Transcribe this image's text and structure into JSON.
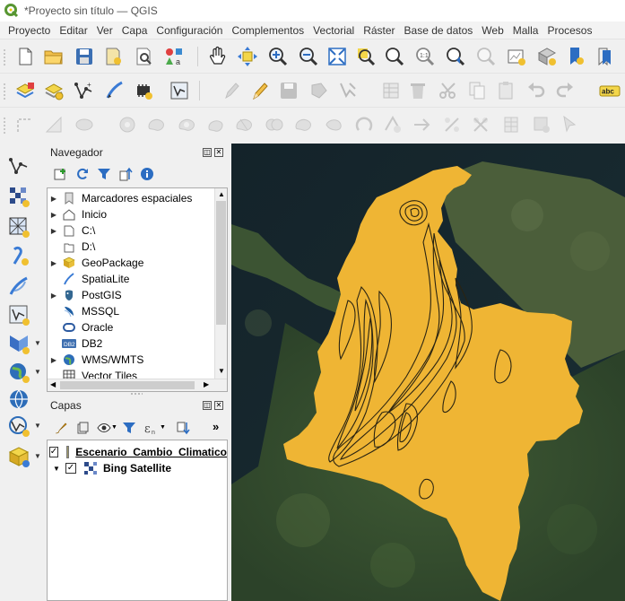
{
  "window": {
    "title": "*Proyecto sin título — QGIS"
  },
  "menu": [
    "Proyecto",
    "Editar",
    "Ver",
    "Capa",
    "Configuración",
    "Complementos",
    "Vectorial",
    "Ráster",
    "Base de datos",
    "Web",
    "Malla",
    "Procesos"
  ],
  "navigator": {
    "title": "Navegador",
    "items": [
      {
        "label": "Marcadores espaciales",
        "icon": "bookmarks-icon",
        "expandable": true
      },
      {
        "label": "Inicio",
        "icon": "home-icon",
        "expandable": true
      },
      {
        "label": "C:\\",
        "icon": "drive-icon",
        "expandable": true
      },
      {
        "label": "D:\\",
        "icon": "drive-icon",
        "expandable": true
      },
      {
        "label": "GeoPackage",
        "icon": "geopackage-icon",
        "expandable": true
      },
      {
        "label": "SpatiaLite",
        "icon": "spatialite-icon",
        "expandable": false
      },
      {
        "label": "PostGIS",
        "icon": "postgis-icon",
        "expandable": true
      },
      {
        "label": "MSSQL",
        "icon": "mssql-icon",
        "expandable": false
      },
      {
        "label": "Oracle",
        "icon": "oracle-icon",
        "expandable": false
      },
      {
        "label": "DB2",
        "icon": "db2-icon",
        "expandable": false
      },
      {
        "label": "WMS/WMTS",
        "icon": "wms-icon",
        "expandable": true
      },
      {
        "label": "Vector Tiles",
        "icon": "vector-tiles-icon",
        "expandable": false
      }
    ],
    "db2_badge": "DB2"
  },
  "layers": {
    "title": "Capas",
    "items": [
      {
        "label": "Escenario_Cambio_Climatico",
        "checked": true,
        "swatch": "#a09a6a",
        "underline": true
      },
      {
        "label": "Bing Satellite",
        "checked": true,
        "icon": "raster-icon"
      }
    ],
    "more": "»"
  },
  "colors": {
    "polygon_fill": "#efb534",
    "contour_stroke": "#2a2412",
    "qgis_green": "#589632"
  },
  "toolbar_badge": "abc"
}
